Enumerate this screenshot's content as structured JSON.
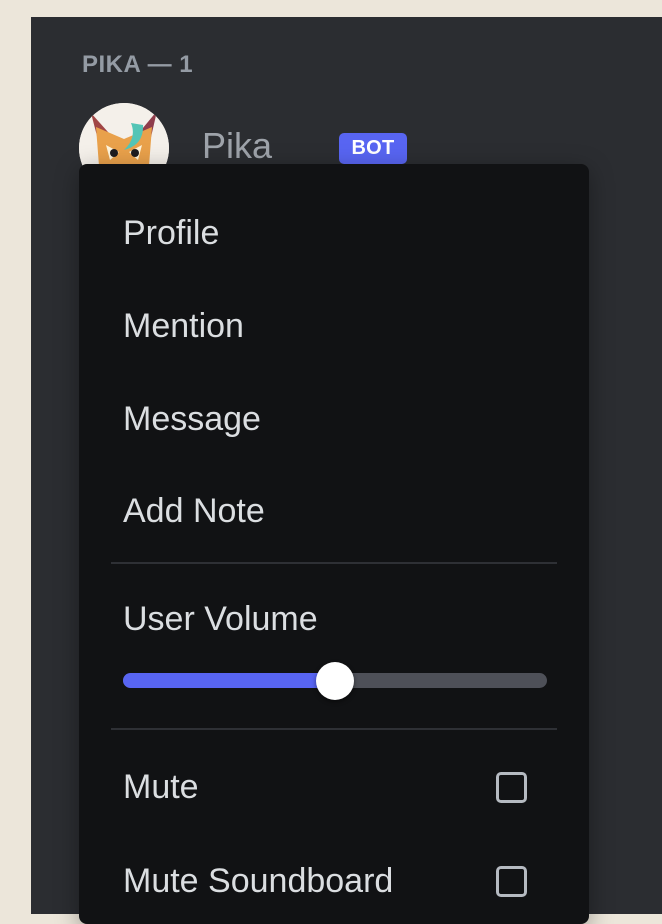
{
  "member_list": {
    "group_header": "PIKA — 1",
    "member": {
      "name": "Pika",
      "badge": "BOT",
      "avatar_icon": "fox-avatar-icon"
    }
  },
  "context_menu": {
    "items": [
      {
        "label": "Profile"
      },
      {
        "label": "Mention"
      },
      {
        "label": "Message"
      },
      {
        "label": "Add Note"
      }
    ],
    "user_volume": {
      "label": "User Volume",
      "value_percent": 50
    },
    "toggles": [
      {
        "label": "Mute",
        "checked": false
      },
      {
        "label": "Mute Soundboard",
        "checked": false
      }
    ]
  },
  "colors": {
    "accent": "#5865f2",
    "menu_background": "#111214",
    "panel_background": "#2b2d31",
    "outer_background": "#ece6da"
  }
}
